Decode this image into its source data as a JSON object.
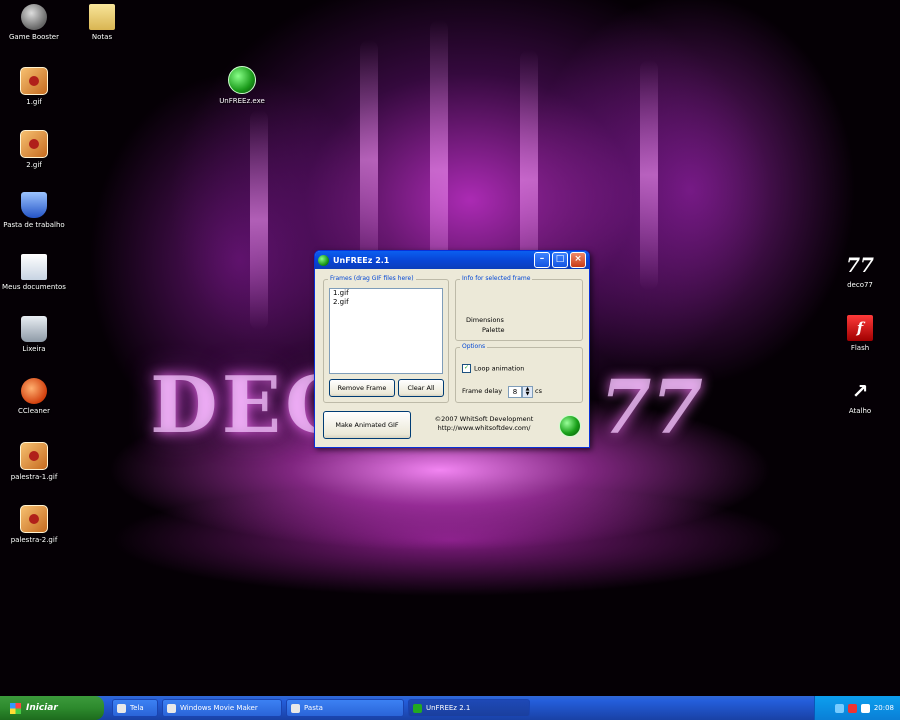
{
  "desktop": {
    "wallpaper_text": "DECO",
    "wallpaper_suffix": "77",
    "icons": [
      {
        "label": "Game Booster"
      },
      {
        "label": "Notas"
      },
      {
        "label": "1.gif"
      },
      {
        "label": "UnFREEz.exe"
      },
      {
        "label": "2.gif"
      },
      {
        "label": "Pasta de trabalho"
      },
      {
        "label": "Meus documentos"
      },
      {
        "label": "Lixeira"
      },
      {
        "label": "CCleaner"
      },
      {
        "label": "palestra-1.gif"
      },
      {
        "label": "palestra-2.gif"
      },
      {
        "label": "deco77"
      },
      {
        "label": "Flash"
      },
      {
        "label": "Atalho"
      }
    ]
  },
  "dialog": {
    "title": "UnFREEz 2.1",
    "frames_group_label": "Frames (drag GIF files here)",
    "frames": [
      "1.gif",
      "2.gif"
    ],
    "remove_frame_label": "Remove Frame",
    "clear_all_label": "Clear All",
    "info_group_label": "Info for selected frame",
    "dimensions_label": "Dimensions",
    "dimensions_value": "Palette",
    "options_group_label": "Options",
    "loop_label": "Loop animation",
    "delay_label": "Frame delay",
    "delay_value": "8",
    "delay_unit": "cs",
    "make_gif_label": "Make Animated GIF",
    "credit_line1": "©2007 WhitSoft Development",
    "credit_line2": "http://www.whitsoftdev.com/"
  },
  "taskbar": {
    "start_label": "Iniciar",
    "tasks": [
      {
        "label": "Tela"
      },
      {
        "label": "Windows Movie Maker"
      },
      {
        "label": "Pasta"
      },
      {
        "label": "UnFREEz 2.1"
      }
    ],
    "clock": "20:08"
  },
  "colors": {
    "title_blue": "#0846d8",
    "start_green": "#2d8a2d",
    "taskbar_blue": "#245edb"
  }
}
